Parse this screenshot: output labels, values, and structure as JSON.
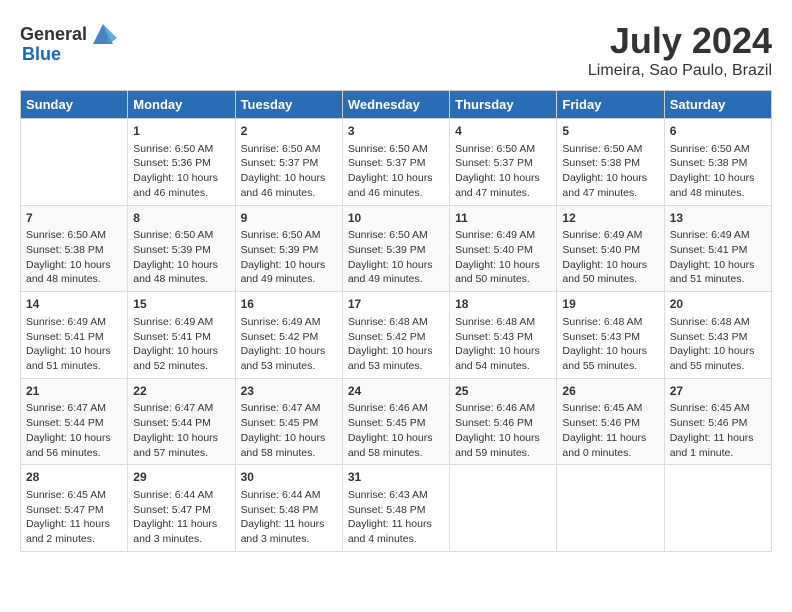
{
  "header": {
    "logo_general": "General",
    "logo_blue": "Blue",
    "month_year": "July 2024",
    "location": "Limeira, Sao Paulo, Brazil"
  },
  "days_of_week": [
    "Sunday",
    "Monday",
    "Tuesday",
    "Wednesday",
    "Thursday",
    "Friday",
    "Saturday"
  ],
  "weeks": [
    [
      {
        "day": "",
        "content": ""
      },
      {
        "day": "1",
        "content": "Sunrise: 6:50 AM\nSunset: 5:36 PM\nDaylight: 10 hours\nand 46 minutes."
      },
      {
        "day": "2",
        "content": "Sunrise: 6:50 AM\nSunset: 5:37 PM\nDaylight: 10 hours\nand 46 minutes."
      },
      {
        "day": "3",
        "content": "Sunrise: 6:50 AM\nSunset: 5:37 PM\nDaylight: 10 hours\nand 46 minutes."
      },
      {
        "day": "4",
        "content": "Sunrise: 6:50 AM\nSunset: 5:37 PM\nDaylight: 10 hours\nand 47 minutes."
      },
      {
        "day": "5",
        "content": "Sunrise: 6:50 AM\nSunset: 5:38 PM\nDaylight: 10 hours\nand 47 minutes."
      },
      {
        "day": "6",
        "content": "Sunrise: 6:50 AM\nSunset: 5:38 PM\nDaylight: 10 hours\nand 48 minutes."
      }
    ],
    [
      {
        "day": "7",
        "content": "Sunrise: 6:50 AM\nSunset: 5:38 PM\nDaylight: 10 hours\nand 48 minutes."
      },
      {
        "day": "8",
        "content": "Sunrise: 6:50 AM\nSunset: 5:39 PM\nDaylight: 10 hours\nand 48 minutes."
      },
      {
        "day": "9",
        "content": "Sunrise: 6:50 AM\nSunset: 5:39 PM\nDaylight: 10 hours\nand 49 minutes."
      },
      {
        "day": "10",
        "content": "Sunrise: 6:50 AM\nSunset: 5:39 PM\nDaylight: 10 hours\nand 49 minutes."
      },
      {
        "day": "11",
        "content": "Sunrise: 6:49 AM\nSunset: 5:40 PM\nDaylight: 10 hours\nand 50 minutes."
      },
      {
        "day": "12",
        "content": "Sunrise: 6:49 AM\nSunset: 5:40 PM\nDaylight: 10 hours\nand 50 minutes."
      },
      {
        "day": "13",
        "content": "Sunrise: 6:49 AM\nSunset: 5:41 PM\nDaylight: 10 hours\nand 51 minutes."
      }
    ],
    [
      {
        "day": "14",
        "content": "Sunrise: 6:49 AM\nSunset: 5:41 PM\nDaylight: 10 hours\nand 51 minutes."
      },
      {
        "day": "15",
        "content": "Sunrise: 6:49 AM\nSunset: 5:41 PM\nDaylight: 10 hours\nand 52 minutes."
      },
      {
        "day": "16",
        "content": "Sunrise: 6:49 AM\nSunset: 5:42 PM\nDaylight: 10 hours\nand 53 minutes."
      },
      {
        "day": "17",
        "content": "Sunrise: 6:48 AM\nSunset: 5:42 PM\nDaylight: 10 hours\nand 53 minutes."
      },
      {
        "day": "18",
        "content": "Sunrise: 6:48 AM\nSunset: 5:43 PM\nDaylight: 10 hours\nand 54 minutes."
      },
      {
        "day": "19",
        "content": "Sunrise: 6:48 AM\nSunset: 5:43 PM\nDaylight: 10 hours\nand 55 minutes."
      },
      {
        "day": "20",
        "content": "Sunrise: 6:48 AM\nSunset: 5:43 PM\nDaylight: 10 hours\nand 55 minutes."
      }
    ],
    [
      {
        "day": "21",
        "content": "Sunrise: 6:47 AM\nSunset: 5:44 PM\nDaylight: 10 hours\nand 56 minutes."
      },
      {
        "day": "22",
        "content": "Sunrise: 6:47 AM\nSunset: 5:44 PM\nDaylight: 10 hours\nand 57 minutes."
      },
      {
        "day": "23",
        "content": "Sunrise: 6:47 AM\nSunset: 5:45 PM\nDaylight: 10 hours\nand 58 minutes."
      },
      {
        "day": "24",
        "content": "Sunrise: 6:46 AM\nSunset: 5:45 PM\nDaylight: 10 hours\nand 58 minutes."
      },
      {
        "day": "25",
        "content": "Sunrise: 6:46 AM\nSunset: 5:46 PM\nDaylight: 10 hours\nand 59 minutes."
      },
      {
        "day": "26",
        "content": "Sunrise: 6:45 AM\nSunset: 5:46 PM\nDaylight: 11 hours\nand 0 minutes."
      },
      {
        "day": "27",
        "content": "Sunrise: 6:45 AM\nSunset: 5:46 PM\nDaylight: 11 hours\nand 1 minute."
      }
    ],
    [
      {
        "day": "28",
        "content": "Sunrise: 6:45 AM\nSunset: 5:47 PM\nDaylight: 11 hours\nand 2 minutes."
      },
      {
        "day": "29",
        "content": "Sunrise: 6:44 AM\nSunset: 5:47 PM\nDaylight: 11 hours\nand 3 minutes."
      },
      {
        "day": "30",
        "content": "Sunrise: 6:44 AM\nSunset: 5:48 PM\nDaylight: 11 hours\nand 3 minutes."
      },
      {
        "day": "31",
        "content": "Sunrise: 6:43 AM\nSunset: 5:48 PM\nDaylight: 11 hours\nand 4 minutes."
      },
      {
        "day": "",
        "content": ""
      },
      {
        "day": "",
        "content": ""
      },
      {
        "day": "",
        "content": ""
      }
    ]
  ]
}
